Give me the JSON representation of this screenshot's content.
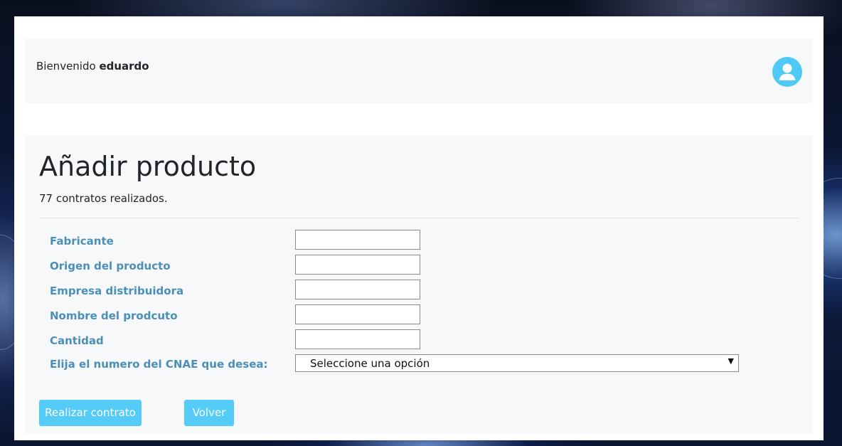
{
  "header": {
    "welcome_prefix": "Bienvenido",
    "username": "eduardo",
    "avatar_icon": "user-circle-icon",
    "accent_color": "#4fcaf6"
  },
  "main": {
    "title": "Añadir producto",
    "subtitle": "77 contratos realizados.",
    "fields": [
      {
        "label": "Fabricante",
        "value": ""
      },
      {
        "label": "Origen del producto",
        "value": ""
      },
      {
        "label": "Empresa distribuidora",
        "value": ""
      },
      {
        "label": "Nombre del prodcuto",
        "value": ""
      },
      {
        "label": "Cantidad",
        "value": ""
      }
    ],
    "cnae": {
      "label": "Elija el numero del CNAE que desea:",
      "selected": "Seleccione una opción"
    },
    "buttons": {
      "submit": "Realizar contrato",
      "back": "Volver"
    }
  }
}
